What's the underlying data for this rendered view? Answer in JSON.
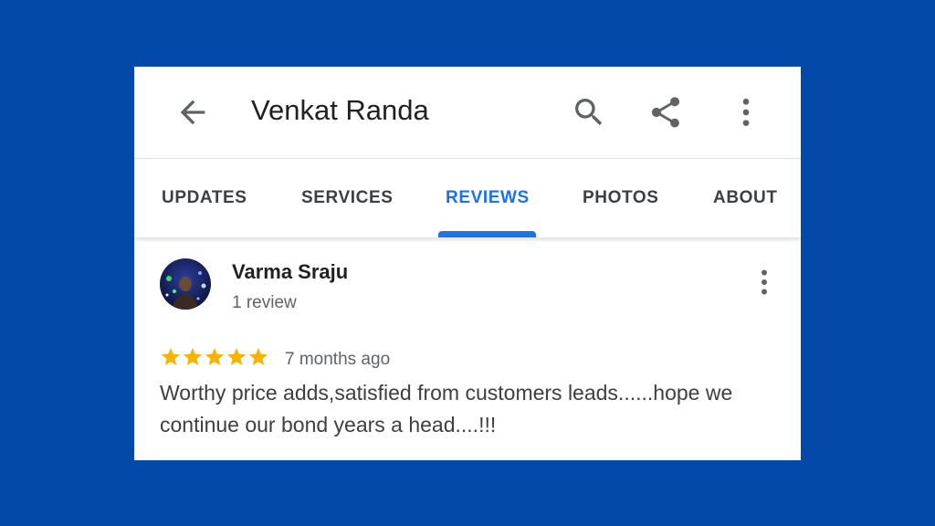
{
  "colors": {
    "background": "#0448a8",
    "accent": "#1a73e8",
    "star": "#f4b400"
  },
  "appbar": {
    "title": "Venkat Randa",
    "icons": [
      "back-arrow-icon",
      "search-icon",
      "share-icon",
      "more-vert-icon"
    ]
  },
  "tabs": [
    {
      "label": "UPDATES",
      "active": false
    },
    {
      "label": "SERVICES",
      "active": false
    },
    {
      "label": "REVIEWS",
      "active": true
    },
    {
      "label": "PHOTOS",
      "active": false
    },
    {
      "label": "ABOUT",
      "active": false
    }
  ],
  "review": {
    "reviewer_name": "Varma Sraju",
    "reviewer_meta": "1 review",
    "rating": 5,
    "rating_max": 5,
    "time": "7 months ago",
    "text": "Worthy price adds,satisfied from customers leads......hope we continue our bond years a head....!!!"
  }
}
